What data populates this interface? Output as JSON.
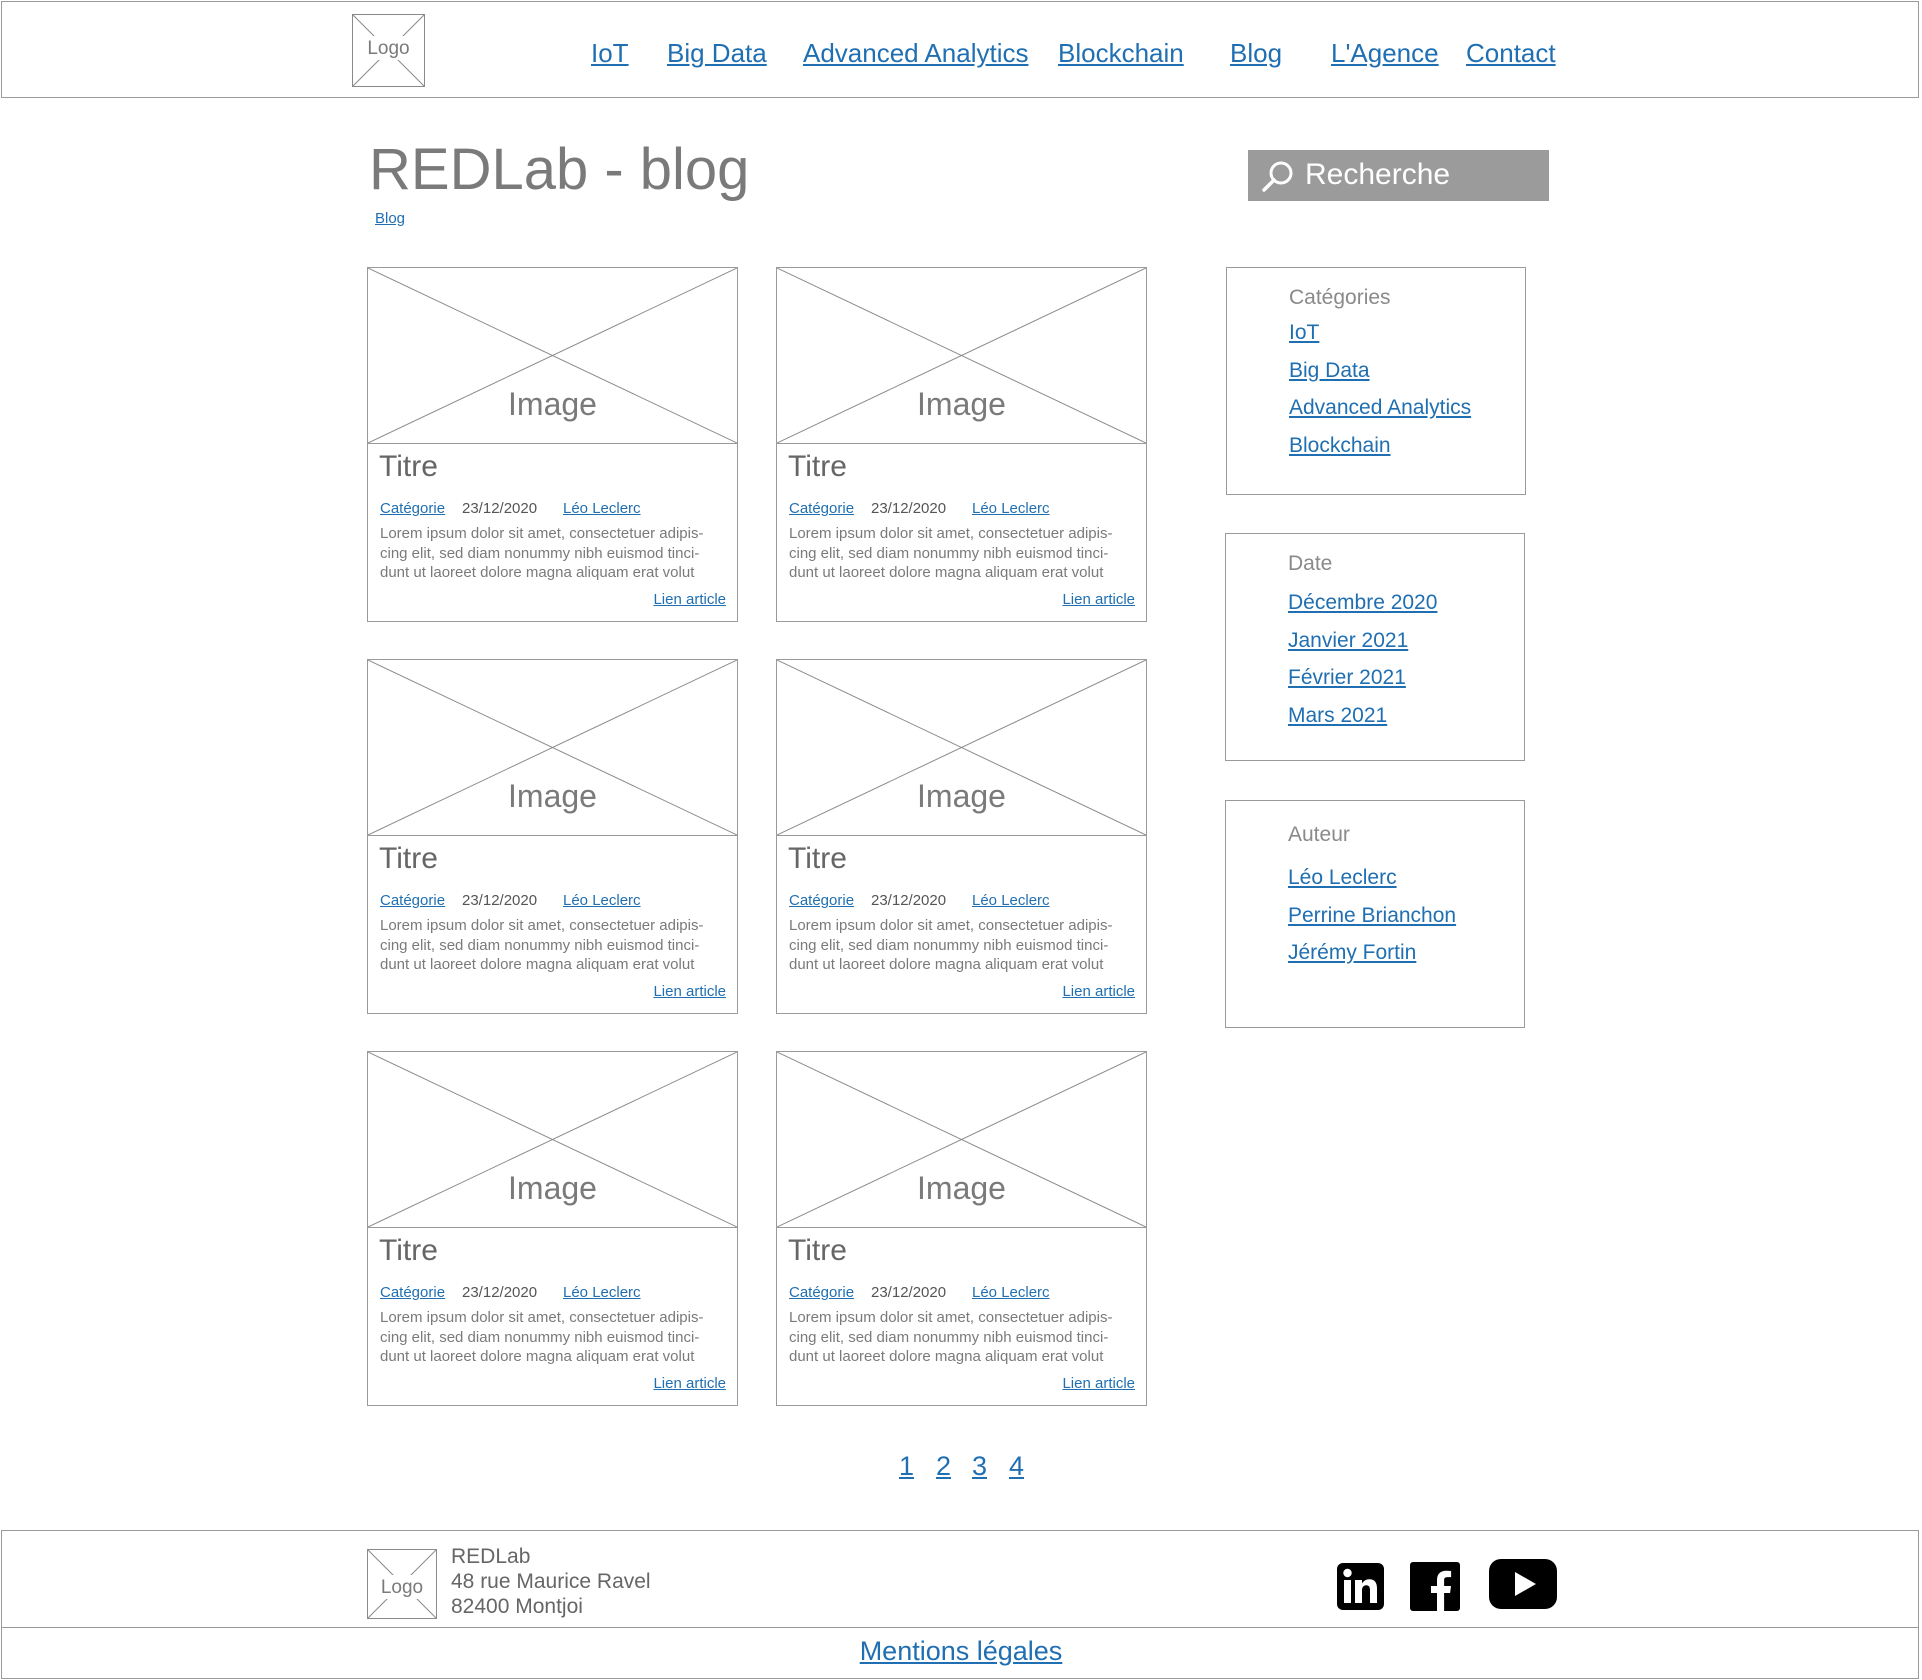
{
  "header": {
    "logo_label": "Logo",
    "nav": [
      {
        "label": "IoT"
      },
      {
        "label": "Big Data"
      },
      {
        "label": "Advanced Analytics"
      },
      {
        "label": "Blockchain"
      },
      {
        "label": "Blog"
      },
      {
        "label": "L'Agence"
      },
      {
        "label": "Contact"
      }
    ]
  },
  "page": {
    "title": "REDLab - blog",
    "breadcrumb": "Blog",
    "search_placeholder": "Recherche"
  },
  "cards": [
    {
      "image_label": "Image",
      "title": "Titre",
      "category": "Catégorie",
      "date": "23/12/2020",
      "author": "Léo Leclerc",
      "excerpt": [
        "Lorem ipsum dolor sit amet, consectetuer adipis-",
        "cing elit, sed diam nonummy nibh euismod tinci-",
        "dunt ut laoreet dolore magna aliquam erat volut"
      ],
      "link": "Lien article"
    },
    {
      "image_label": "Image",
      "title": "Titre",
      "category": "Catégorie",
      "date": "23/12/2020",
      "author": "Léo Leclerc",
      "excerpt": [
        "Lorem ipsum dolor sit amet, consectetuer adipis-",
        "cing elit, sed diam nonummy nibh euismod tinci-",
        "dunt ut laoreet dolore magna aliquam erat volut"
      ],
      "link": "Lien article"
    },
    {
      "image_label": "Image",
      "title": "Titre",
      "category": "Catégorie",
      "date": "23/12/2020",
      "author": "Léo Leclerc",
      "excerpt": [
        "Lorem ipsum dolor sit amet, consectetuer adipis-",
        "cing elit, sed diam nonummy nibh euismod tinci-",
        "dunt ut laoreet dolore magna aliquam erat volut"
      ],
      "link": "Lien article"
    },
    {
      "image_label": "Image",
      "title": "Titre",
      "category": "Catégorie",
      "date": "23/12/2020",
      "author": "Léo Leclerc",
      "excerpt": [
        "Lorem ipsum dolor sit amet, consectetuer adipis-",
        "cing elit, sed diam nonummy nibh euismod tinci-",
        "dunt ut laoreet dolore magna aliquam erat volut"
      ],
      "link": "Lien article"
    },
    {
      "image_label": "Image",
      "title": "Titre",
      "category": "Catégorie",
      "date": "23/12/2020",
      "author": "Léo Leclerc",
      "excerpt": [
        "Lorem ipsum dolor sit amet, consectetuer adipis-",
        "cing elit, sed diam nonummy nibh euismod tinci-",
        "dunt ut laoreet dolore magna aliquam erat volut"
      ],
      "link": "Lien article"
    },
    {
      "image_label": "Image",
      "title": "Titre",
      "category": "Catégorie",
      "date": "23/12/2020",
      "author": "Léo Leclerc",
      "excerpt": [
        "Lorem ipsum dolor sit amet, consectetuer adipis-",
        "cing elit, sed diam nonummy nibh euismod tinci-",
        "dunt ut laoreet dolore magna aliquam erat volut"
      ],
      "link": "Lien article"
    }
  ],
  "sidebar": {
    "categories": {
      "heading": "Catégories",
      "items": [
        "IoT",
        "Big Data",
        "Advanced Analytics",
        "Blockchain"
      ]
    },
    "dates": {
      "heading": "Date",
      "items": [
        "Décembre 2020",
        "Janvier 2021",
        "Février 2021",
        "Mars 2021"
      ]
    },
    "authors": {
      "heading": "Auteur",
      "items": [
        "Léo Leclerc",
        "Perrine Brianchon",
        "Jérémy Fortin"
      ]
    }
  },
  "pagination": [
    "1",
    "2",
    "3",
    "4"
  ],
  "footer": {
    "logo_label": "Logo",
    "company": "REDLab",
    "address_line": "48 rue Maurice Ravel",
    "city_line": "82400 Montjoi",
    "social": [
      "linkedin-icon",
      "facebook-icon",
      "youtube-icon"
    ],
    "legal": "Mentions légales"
  },
  "colors": {
    "link": "#1f6fb2",
    "search_bg": "#9b9b9b",
    "border": "#9a9a9a"
  }
}
